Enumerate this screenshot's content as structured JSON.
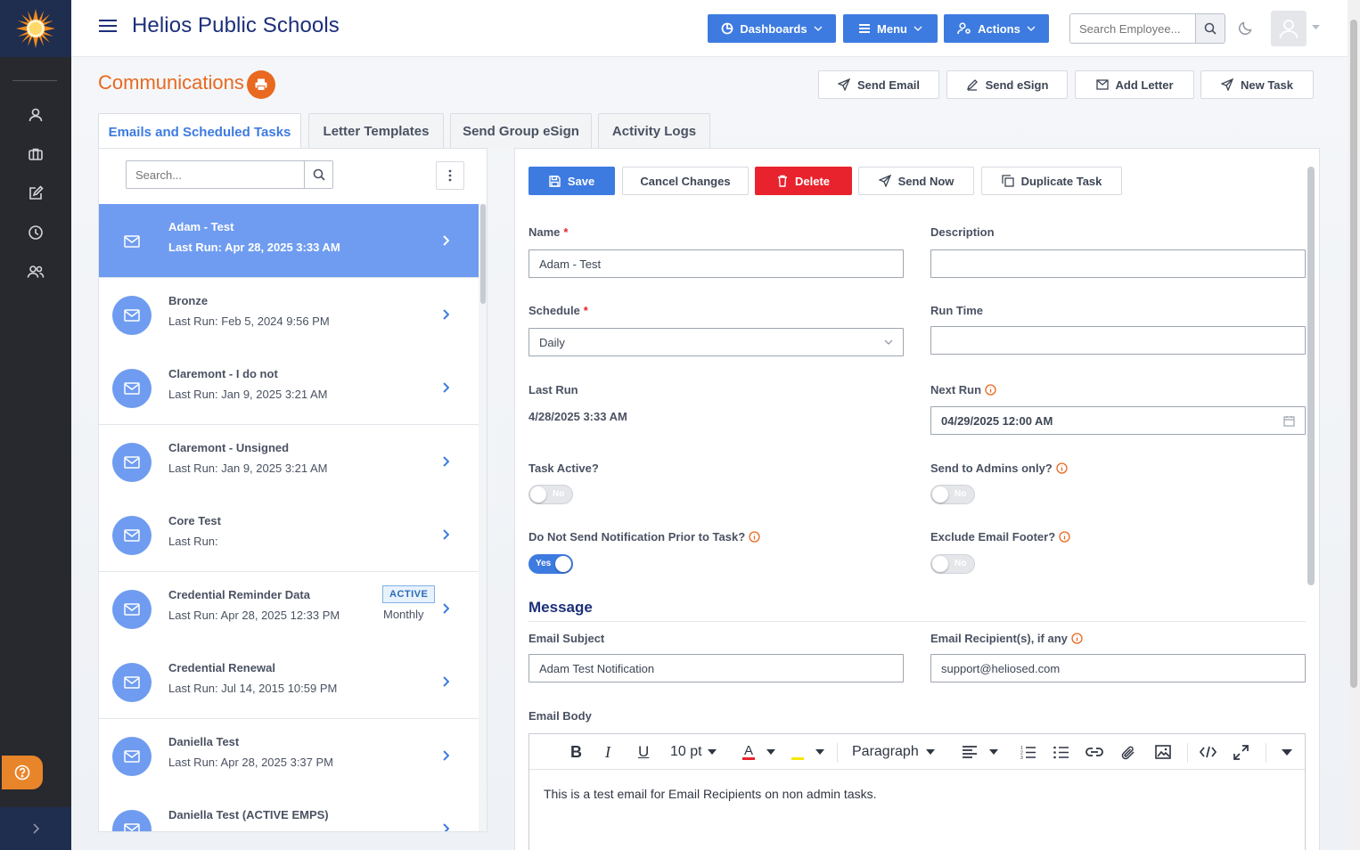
{
  "header": {
    "app_title": "Helios Public Schools",
    "dashboards_label": "Dashboards",
    "menu_label": "Menu",
    "actions_label": "Actions",
    "search_placeholder": "Search Employee..."
  },
  "sidebar": {
    "items": [
      {
        "icon": "user-icon"
      },
      {
        "icon": "briefcase-icon"
      },
      {
        "icon": "edit-icon"
      },
      {
        "icon": "clock-icon"
      },
      {
        "icon": "users-icon"
      }
    ]
  },
  "page": {
    "title": "Communications",
    "buttons": {
      "send_email": "Send Email",
      "send_esign": "Send eSign",
      "add_letter": "Add Letter",
      "new_task": "New Task"
    }
  },
  "tabs": [
    {
      "label": "Emails and Scheduled Tasks",
      "active": true
    },
    {
      "label": "Letter Templates"
    },
    {
      "label": "Send Group eSign"
    },
    {
      "label": "Activity Logs"
    }
  ],
  "list": {
    "search_placeholder": "Search...",
    "items": [
      {
        "name": "Adam - Test",
        "last_run": "Last Run: Apr 28, 2025 3:33 AM",
        "selected": true
      },
      {
        "name": "Bronze",
        "last_run": "Last Run: Feb 5, 2024 9:56 PM"
      },
      {
        "name": "Claremont - I do not",
        "last_run": "Last Run: Jan 9, 2025 3:21 AM"
      },
      {
        "name": "Claremont - Unsigned",
        "last_run": "Last Run: Jan 9, 2025 3:21 AM"
      },
      {
        "name": "Core Test",
        "last_run": "Last Run:"
      },
      {
        "name": "Credential Reminder Data",
        "last_run": "Last Run: Apr 28, 2025 12:33 PM",
        "badge": "ACTIVE",
        "frequency": "Monthly"
      },
      {
        "name": "Credential Renewal",
        "last_run": "Last Run: Jul 14, 2015 10:59 PM"
      },
      {
        "name": "Daniella Test",
        "last_run": "Last Run: Apr 28, 2025 3:37 PM"
      },
      {
        "name": "Daniella Test (ACTIVE EMPS)",
        "last_run": ""
      }
    ]
  },
  "detail": {
    "buttons": {
      "save": "Save",
      "cancel": "Cancel Changes",
      "delete": "Delete",
      "send_now": "Send Now",
      "duplicate": "Duplicate Task"
    },
    "name_label": "Name",
    "name_value": "Adam - Test",
    "description_label": "Description",
    "description_value": "",
    "schedule_label": "Schedule",
    "schedule_value": "Daily",
    "run_time_label": "Run Time",
    "run_time_value": "",
    "last_run_label": "Last Run",
    "last_run_value": "4/28/2025 3:33 AM",
    "next_run_label": "Next Run",
    "next_run_value": "04/29/2025 12:00 AM",
    "task_active_label": "Task Active?",
    "task_active_value": "No",
    "send_admins_label": "Send to Admins only?",
    "send_admins_value": "No",
    "no_notify_label": "Do Not Send Notification Prior to Task?",
    "no_notify_value": "Yes",
    "exclude_footer_label": "Exclude Email Footer?",
    "exclude_footer_value": "No",
    "message_heading": "Message",
    "subject_label": "Email Subject",
    "subject_value": "Adam Test Notification",
    "recipients_label": "Email Recipient(s), if any",
    "recipients_value": "support@heliosed.com",
    "body_label": "Email Body",
    "editor": {
      "font_size": "10 pt",
      "block_format": "Paragraph",
      "body_text": "This is a test email for Email Recipients on non admin tasks."
    }
  },
  "colors": {
    "primary": "#3d7be0",
    "accent_orange": "#e8691f",
    "danger": "#e8232d",
    "navy": "#1c2f7a",
    "sidebar": "#27292e",
    "selected_row": "#6f9cf0"
  }
}
